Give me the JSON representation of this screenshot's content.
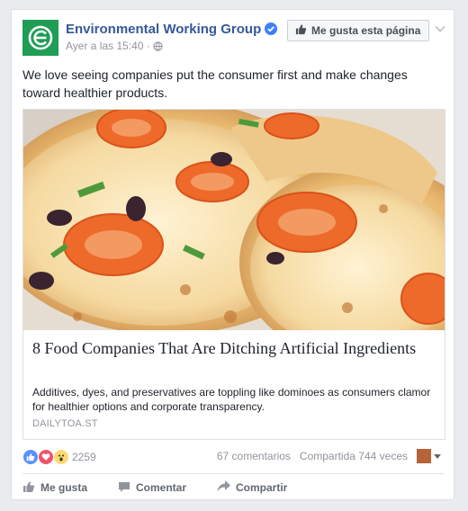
{
  "post": {
    "page_name": "Environmental Working Group",
    "timestamp": "Ayer a las 15:40",
    "separator": "·",
    "like_page_label": "Me gusta esta página",
    "text": "We love seeing companies put the consumer first and make changes toward healthier products."
  },
  "link": {
    "title": "8 Food Companies That Are Ditching Artificial Ingredients",
    "description": "Additives, dyes, and preservatives are toppling like dominoes as consumers clamor for healthier options and corporate transparency.",
    "domain": "DAILYTOA.ST"
  },
  "stats": {
    "reaction_count": "2259",
    "comments": "67 comentarios",
    "shares": "Compartida 744 veces"
  },
  "actions": {
    "like": "Me gusta",
    "comment": "Comentar",
    "share": "Compartir"
  },
  "colors": {
    "brand_blue": "#365899",
    "ewg_green": "#1f9d55",
    "like_blue": "#5890ff",
    "love_red": "#f25268",
    "wow_yellow": "#ffd972"
  },
  "icons": {
    "verified": "verified-badge-icon",
    "globe": "globe-icon",
    "thumb": "thumbs-up-icon",
    "chevron": "chevron-down-icon",
    "comment": "comment-bubble-icon",
    "share": "share-arrow-icon"
  }
}
